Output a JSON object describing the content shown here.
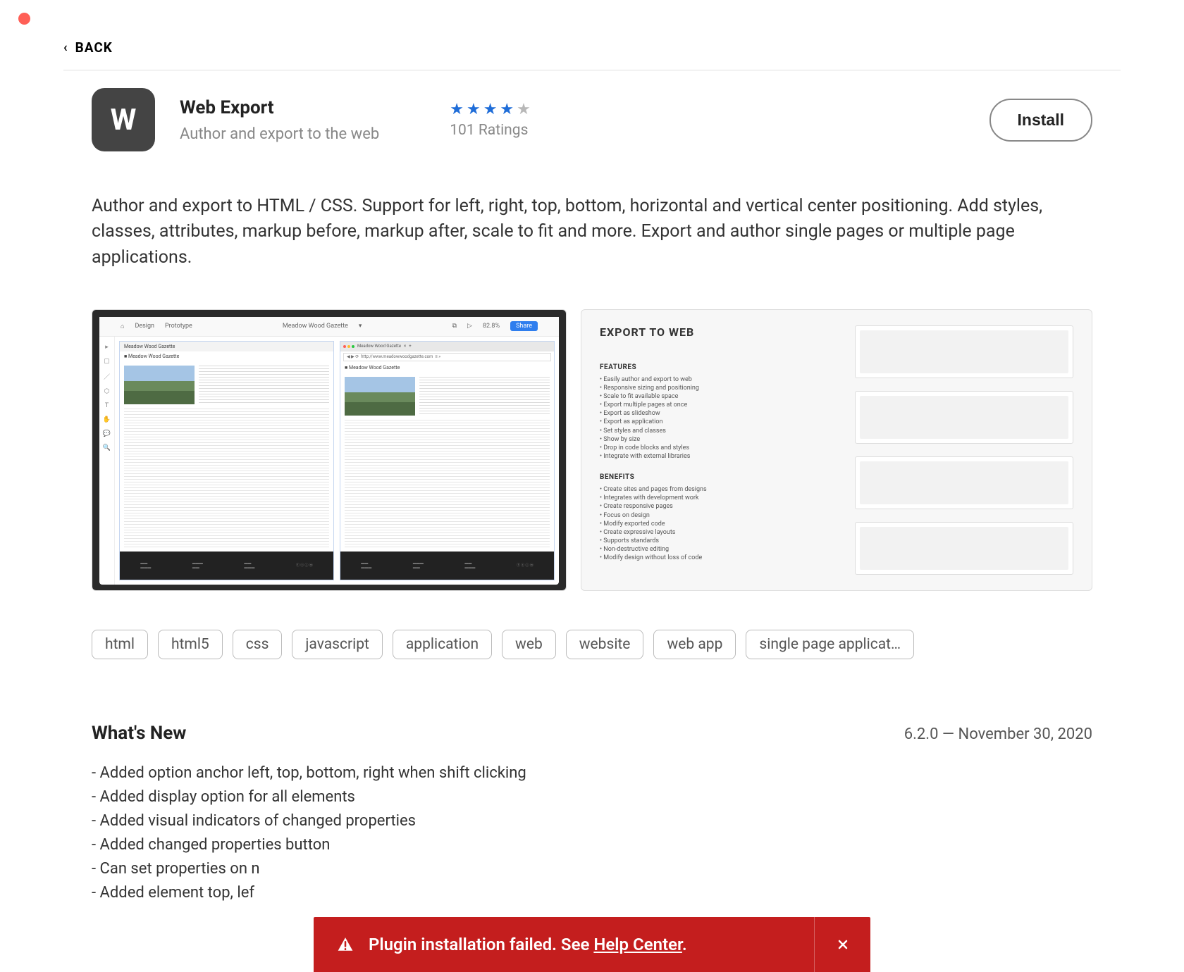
{
  "back_label": "BACK",
  "plugin": {
    "icon_letter": "W",
    "name": "Web Export",
    "subtitle": "Author and export to the web",
    "rating_stars": 4,
    "rating_count_label": "101 Ratings",
    "install_label": "Install"
  },
  "description": "Author and export to HTML / CSS. Support for left, right, top, bottom, horizontal and vertical center positioning. Add styles, classes, attributes, markup before, markup after, scale to fit and more. Export and author single pages or multiple page applications.",
  "screenshot1": {
    "design_tab": "Design",
    "proto_tab": "Prototype",
    "doc_title": "Meadow Wood Gazette",
    "zoom": "82.8%",
    "share": "Share",
    "url": "http://www.meadowwoodgazette.com"
  },
  "screenshot2": {
    "title": "EXPORT TO WEB",
    "features_label": "FEATURES",
    "features": "• Easily author and export to web\n• Responsive sizing and positioning\n• Scale to fit available space\n• Export multiple pages at once\n• Export as slideshow\n• Export as application\n• Set styles and classes\n• Show by size\n• Drop in code blocks and styles\n• Integrate with external libraries",
    "benefits_label": "BENEFITS",
    "benefits": "• Create sites and pages from designs\n• Integrates with development work\n• Create responsive pages\n• Focus on design\n• Modify exported code\n• Create expressive layouts\n• Supports standards\n• Non-destructive editing\n• Modify design without loss of code"
  },
  "tags": [
    "html",
    "html5",
    "css",
    "javascript",
    "application",
    "web",
    "website",
    "web app",
    "single page applicat…"
  ],
  "whatsnew": {
    "title": "What's New",
    "version": "6.2.0",
    "sep": " — ",
    "date": "November 30, 2020",
    "items": [
      "- Added option anchor left, top, bottom, right when shift clicking",
      "- Added display option for all elements",
      "- Added visual indicators of changed properties",
      "- Added changed properties button",
      "- Can set properties on n",
      "- Added element top, lef"
    ]
  },
  "toast": {
    "message_prefix": "Plugin installation failed. See ",
    "link": "Help Center",
    "suffix": "."
  }
}
